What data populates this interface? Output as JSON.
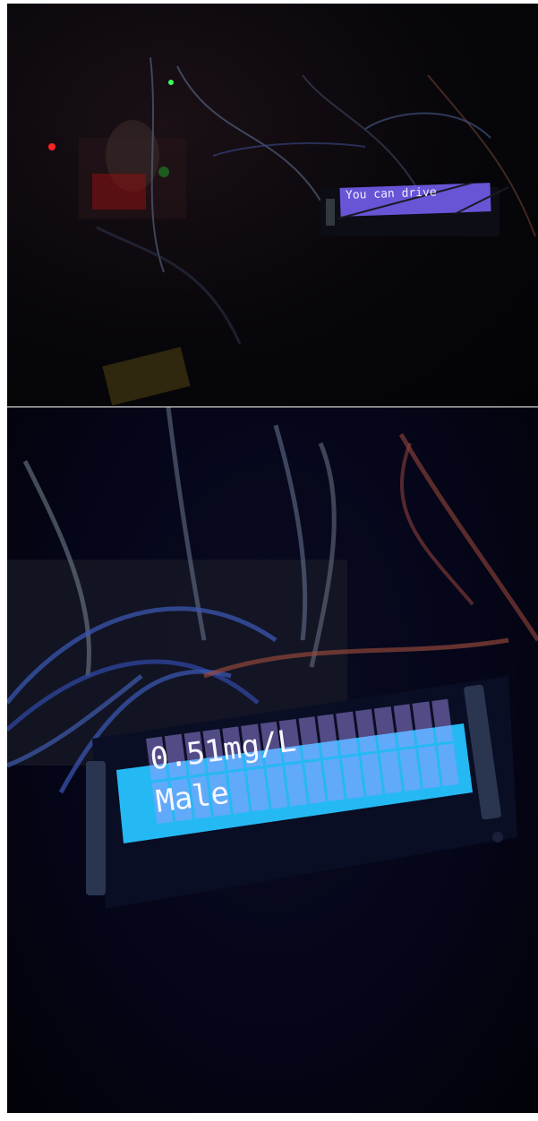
{
  "top_photo": {
    "lcd": {
      "line1": "You can drive",
      "line2": ""
    },
    "colors": {
      "lcd_backlight": "#8a72ff",
      "background": "#07060a"
    }
  },
  "bottom_photo": {
    "lcd": {
      "line1": "0.51mg/L",
      "line2": "Male"
    },
    "colors": {
      "lcd_backlight": "#21b8f5",
      "background": "#05061a"
    }
  }
}
